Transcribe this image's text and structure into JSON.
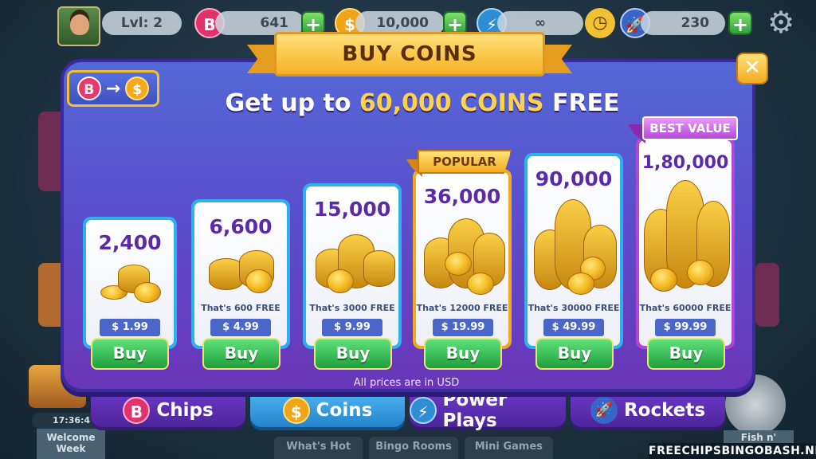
{
  "hud": {
    "level": "Lvl: 2",
    "chips": "641",
    "coins": "10,000",
    "powerplays": "∞",
    "rockets": "230",
    "chip_glyph": "B",
    "coin_glyph": "$"
  },
  "modal": {
    "title": "BUY COINS",
    "headline_prefix": "Get up to ",
    "headline_highlight": "60,000 COINS",
    "headline_suffix": " FREE",
    "close_glyph": "✕",
    "disclaimer": "All prices are in USD",
    "convert": {
      "from": "B",
      "arrow": "→",
      "to": "$"
    }
  },
  "offers": [
    {
      "amount": "2,400",
      "free": "",
      "price": "$ 1.99",
      "buy": "Buy",
      "tag": ""
    },
    {
      "amount": "6,600",
      "free": "That's 600 FREE",
      "price": "$ 4.99",
      "buy": "Buy",
      "tag": ""
    },
    {
      "amount": "15,000",
      "free": "That's 3000 FREE",
      "price": "$ 9.99",
      "buy": "Buy",
      "tag": ""
    },
    {
      "amount": "36,000",
      "free": "That's 12000 FREE",
      "price": "$ 19.99",
      "buy": "Buy",
      "tag": "POPULAR"
    },
    {
      "amount": "90,000",
      "free": "That's 30000 FREE",
      "price": "$ 49.99",
      "buy": "Buy",
      "tag": ""
    },
    {
      "amount": "1,80,000",
      "free": "That's 60000 FREE",
      "price": "$ 99.99",
      "buy": "Buy",
      "tag": "BEST VALUE"
    }
  ],
  "tabs": [
    {
      "label": "Chips",
      "glyph": "B",
      "active": false
    },
    {
      "label": "Coins",
      "glyph": "$",
      "active": true
    },
    {
      "label": "Power Plays",
      "glyph": "⚡",
      "active": false
    },
    {
      "label": "Rockets",
      "glyph": "🚀",
      "active": false
    }
  ],
  "background": {
    "timer": "17:36:4",
    "welcome": "Welcome Week",
    "fish": "Fish n'",
    "nav": [
      "What's Hot",
      "Bingo Rooms",
      "Mini Games"
    ]
  },
  "watermark": "FREECHIPSBINGOBASH.NET",
  "colors": {
    "accent_gold": "#f5b223",
    "modal_purple": "#5a4fcd",
    "buy_green": "#1f9f3c",
    "amount_purple": "#5a2aa8"
  }
}
